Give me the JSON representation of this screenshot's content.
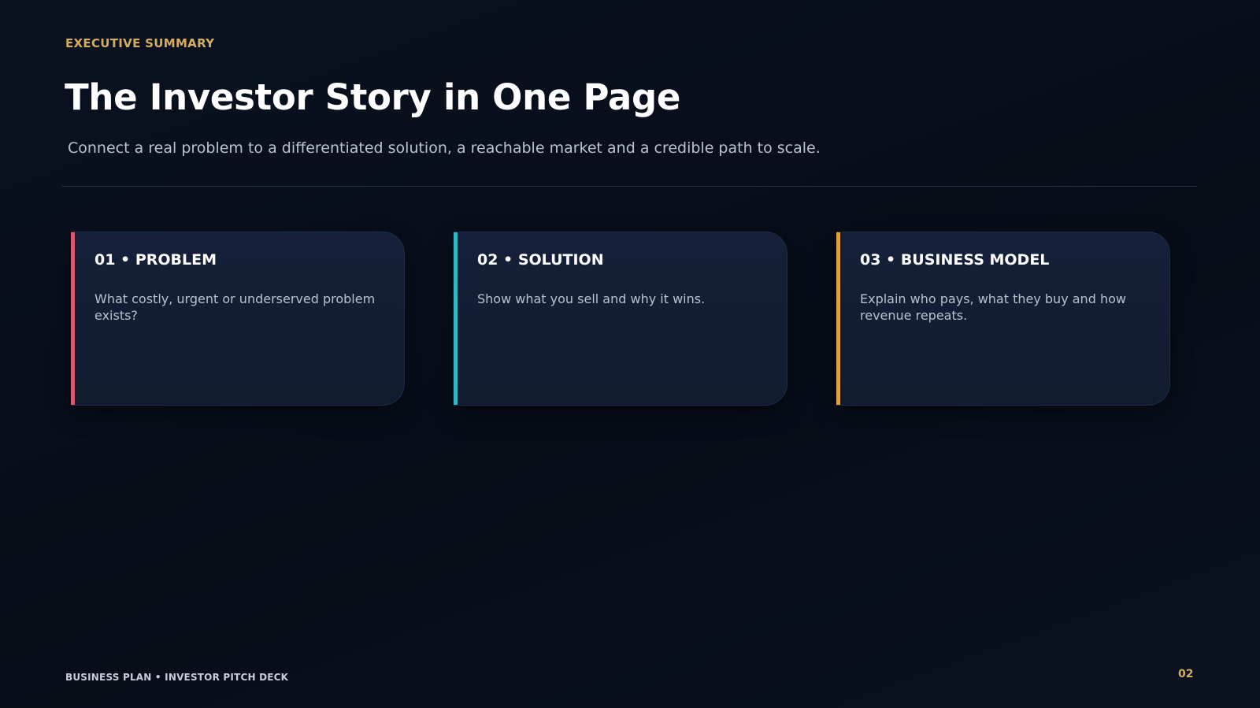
{
  "header": {
    "eyebrow": "EXECUTIVE SUMMARY",
    "title": "The Investor Story in One Page",
    "subtitle": "Connect a real problem to a differentiated solution, a reachable market and a credible path to scale."
  },
  "cards": [
    {
      "title": "01 • PROBLEM",
      "body": "What costly, urgent or underserved problem exists?",
      "accent": "#d95a6e"
    },
    {
      "title": "02 • SOLUTION",
      "body": "Show what you sell and why it wins.",
      "accent": "#2fb8c6"
    },
    {
      "title": "03 • BUSINESS MODEL",
      "body": "Explain who pays, what they buy and how revenue repeats.",
      "accent": "#e0a23f"
    }
  ],
  "footer": {
    "deck_label": "BUSINESS PLAN • INVESTOR PITCH DECK",
    "page_number": "02"
  },
  "colors": {
    "background": "#070c17",
    "eyebrow": "#d6ad5c",
    "card_background": "#15213a"
  }
}
